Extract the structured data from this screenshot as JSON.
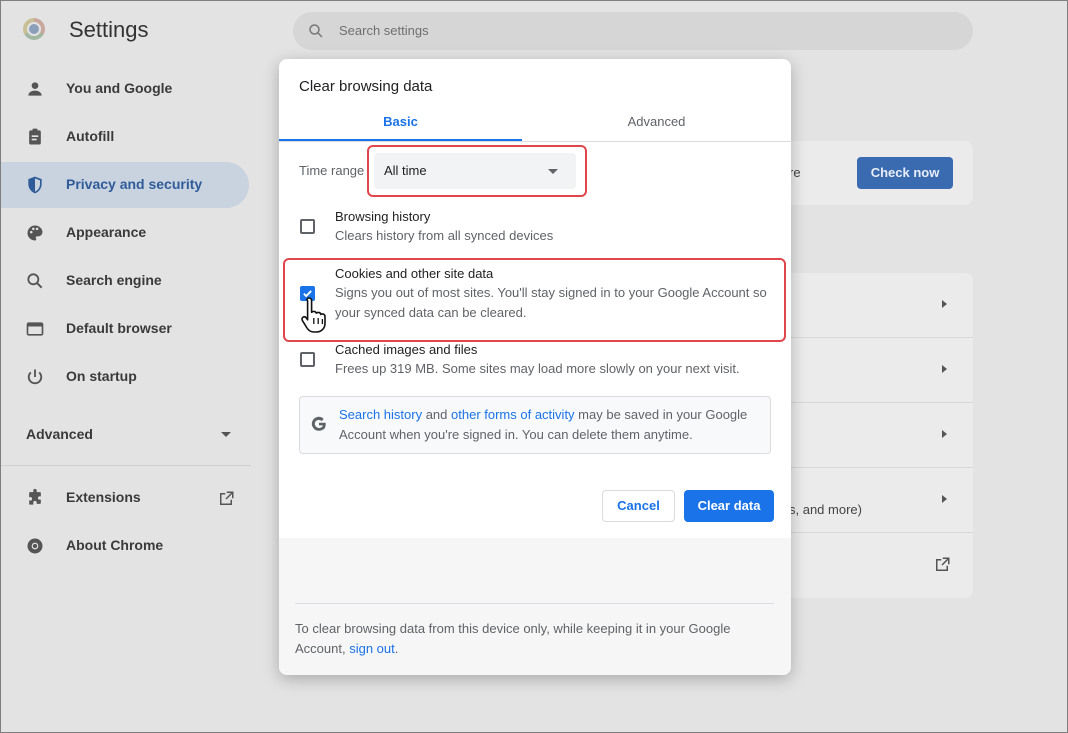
{
  "app": {
    "title": "Settings",
    "search_placeholder": "Search settings"
  },
  "sidebar": {
    "items": [
      {
        "label": "You and Google",
        "icon": "person-icon"
      },
      {
        "label": "Autofill",
        "icon": "clipboard-icon"
      },
      {
        "label": "Privacy and security",
        "icon": "shield-icon",
        "active": true
      },
      {
        "label": "Appearance",
        "icon": "palette-icon"
      },
      {
        "label": "Search engine",
        "icon": "search-icon"
      },
      {
        "label": "Default browser",
        "icon": "browser-window-icon"
      },
      {
        "label": "On startup",
        "icon": "power-icon"
      }
    ],
    "advanced_label": "Advanced",
    "extensions_label": "Extensions",
    "about_label": "About Chrome"
  },
  "background": {
    "check_now_label": "Check now",
    "partial_text_1": "re",
    "partial_text_2": "s, and more)"
  },
  "dialog": {
    "title": "Clear browsing data",
    "tabs": [
      {
        "label": "Basic",
        "selected": true
      },
      {
        "label": "Advanced",
        "selected": false
      }
    ],
    "time_range_label": "Time range",
    "time_range_value": "All time",
    "options": [
      {
        "title": "Browsing history",
        "subtitle": "Clears history from all synced devices",
        "checked": false
      },
      {
        "title": "Cookies and other site data",
        "subtitle": "Signs you out of most sites. You'll stay signed in to your Google Account so your synced data can be cleared.",
        "checked": true
      },
      {
        "title": "Cached images and files",
        "subtitle": "Frees up 319 MB. Some sites may load more slowly on your next visit.",
        "checked": false
      }
    ],
    "info": {
      "link1": "Search history",
      "and": " and ",
      "link2": "other forms of activity",
      "rest": " may be saved in your Google Account when you're signed in. You can delete them anytime."
    },
    "cancel_label": "Cancel",
    "clear_label": "Clear data",
    "footer": {
      "text": "To clear browsing data from this device only, while keeping it in your Google Account, ",
      "link": "sign out",
      "end": "."
    }
  },
  "colors": {
    "accent": "#1a73e8",
    "highlight": "#e0474c"
  }
}
